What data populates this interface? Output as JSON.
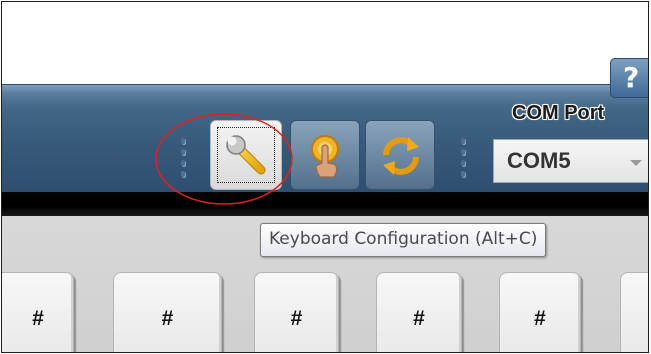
{
  "help": {
    "label": "?"
  },
  "toolbar": {
    "buttons": [
      {
        "name": "keyboard-configuration",
        "icon": "wrench-icon"
      },
      {
        "name": "touch",
        "icon": "touch-hand-icon"
      },
      {
        "name": "refresh",
        "icon": "sync-arrows-icon"
      }
    ],
    "com_port": {
      "label": "COM Port",
      "value": "COM5"
    }
  },
  "tooltip": {
    "text": "Keyboard Configuration (Alt+C)"
  },
  "keys": [
    {
      "label": "#"
    },
    {
      "label": "#"
    },
    {
      "label": "#"
    },
    {
      "label": "#"
    },
    {
      "label": "#"
    },
    {
      "label": ""
    }
  ],
  "colors": {
    "toolbar": "#446888",
    "highlight_ellipse": "#e02020",
    "key_face": "#eeeeee"
  }
}
